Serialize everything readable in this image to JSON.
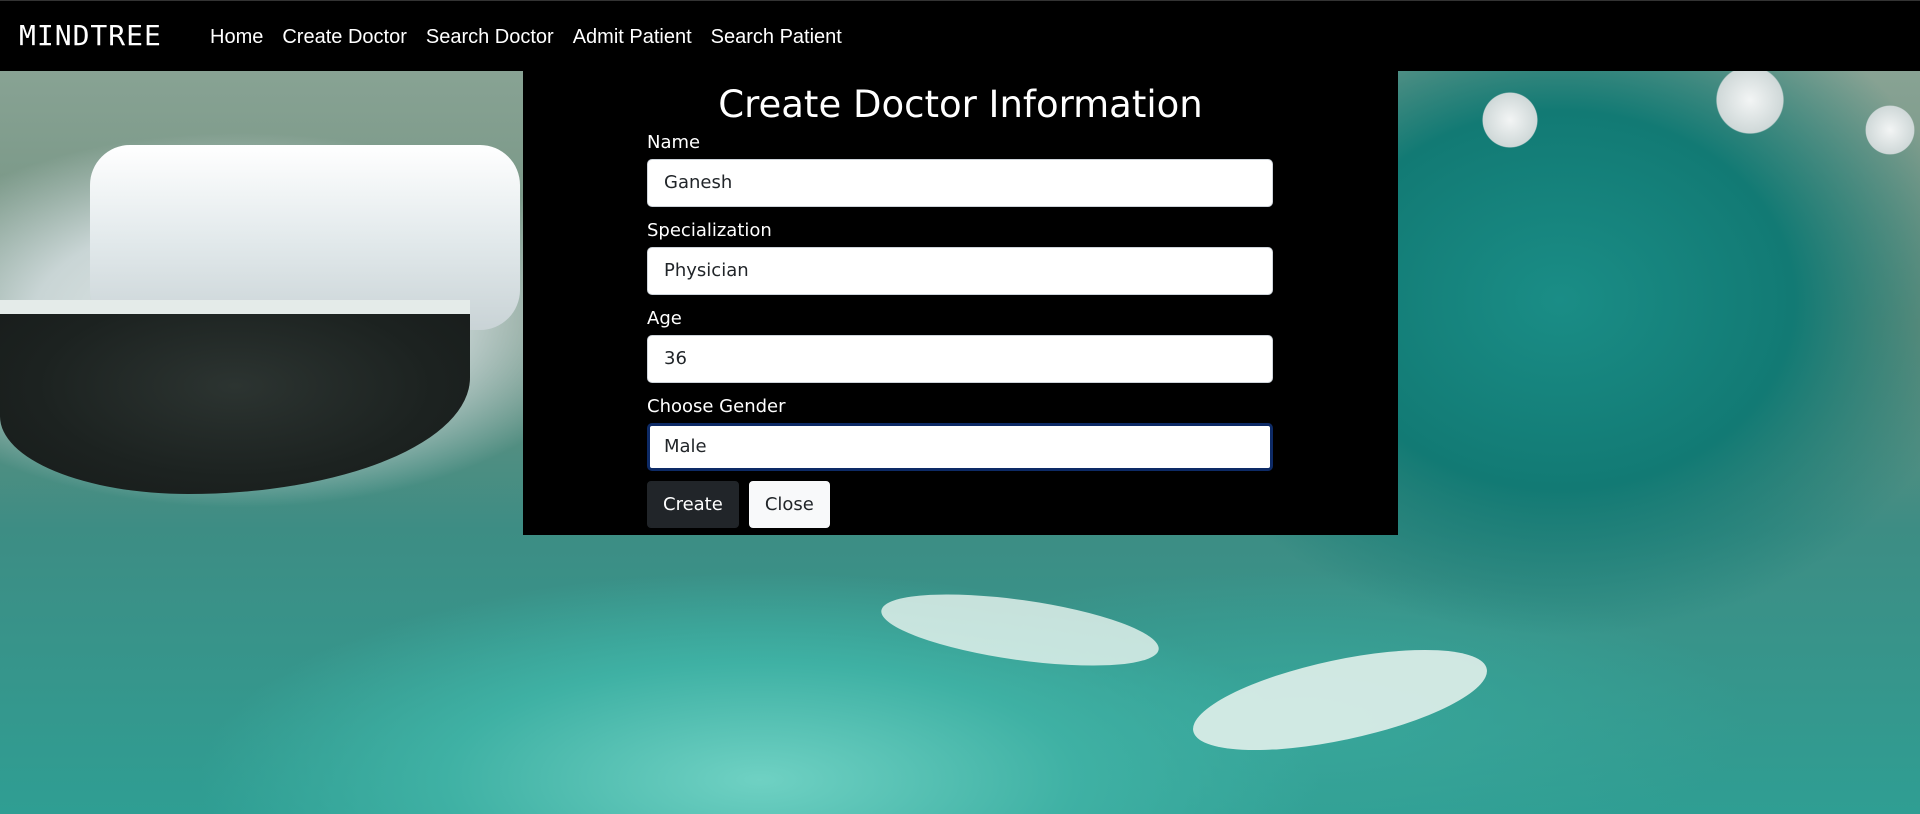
{
  "navbar": {
    "brand": "MINDTREE",
    "links": [
      "Home",
      "Create Doctor",
      "Search Doctor",
      "Admit Patient",
      "Search Patient"
    ]
  },
  "form": {
    "title": "Create Doctor Information",
    "fields": [
      {
        "label": "Name",
        "value": "Ganesh"
      },
      {
        "label": "Specialization",
        "value": "Physician"
      },
      {
        "label": "Age",
        "value": "36"
      },
      {
        "label": "Choose Gender",
        "value": "Male"
      }
    ],
    "create_label": "Create",
    "close_label": "Close"
  },
  "colors": {
    "navbar_bg": "#000000",
    "panel_bg": "#000000",
    "focus_border": "#0d2a66",
    "create_button": "#212529",
    "close_button": "#f8f9fa"
  }
}
